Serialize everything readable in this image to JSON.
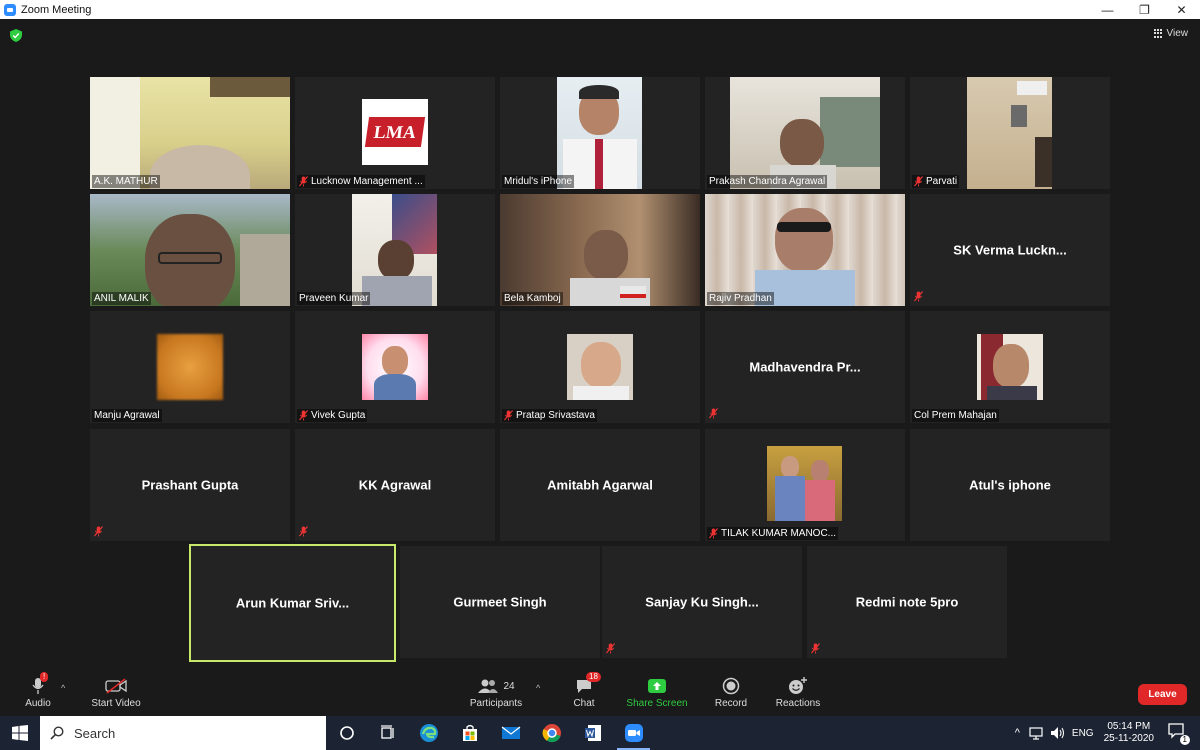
{
  "window": {
    "title": "Zoom Meeting",
    "minimize": "—",
    "restore": "❐",
    "close": "✕"
  },
  "meeting": {
    "view_label": "View",
    "participants": [
      {
        "name": "A.K. MATHUR",
        "muted": false
      },
      {
        "name": "Lucknow Management ...",
        "muted": true
      },
      {
        "name": "Mridul's iPhone",
        "muted": false
      },
      {
        "name": "Prakash Chandra Agrawal",
        "muted": false
      },
      {
        "name": "Parvati",
        "muted": true
      },
      {
        "name": "ANIL MALIK",
        "muted": false
      },
      {
        "name": "Praveen Kumar",
        "muted": false
      },
      {
        "name": "Bela Kamboj",
        "muted": false
      },
      {
        "name": "Rajiv Pradhan",
        "muted": false
      },
      {
        "name": "SK Verma Luckn...",
        "muted": true
      },
      {
        "name": "Manju Agrawal",
        "muted": false
      },
      {
        "name": "Vivek Gupta",
        "muted": true
      },
      {
        "name": "Pratap Srivastava",
        "muted": true
      },
      {
        "name": "Madhavendra Pr...",
        "muted": true
      },
      {
        "name": "Col Prem Mahajan",
        "muted": false
      },
      {
        "name": "Prashant Gupta",
        "muted": true
      },
      {
        "name": "KK Agrawal",
        "muted": true
      },
      {
        "name": "Amitabh Agarwal",
        "muted": false
      },
      {
        "name": "TILAK KUMAR MANOC...",
        "muted": true
      },
      {
        "name": "Atul's iphone",
        "muted": false
      },
      {
        "name": "Arun  Kumar  Sriv...",
        "muted": false
      },
      {
        "name": "Gurmeet Singh",
        "muted": false
      },
      {
        "name": "Sanjay  Ku  Singh...",
        "muted": true
      },
      {
        "name": "Redmi note 5pro",
        "muted": true
      }
    ],
    "logo_text": "LMA"
  },
  "toolbar": {
    "audio_label": "Audio",
    "audio_badge": "!",
    "video_label": "Start Video",
    "participants_label": "Participants",
    "participants_count": "24",
    "chat_label": "Chat",
    "chat_badge": "18",
    "share_label": "Share Screen",
    "record_label": "Record",
    "reactions_label": "Reactions",
    "leave_label": "Leave",
    "caret": "^"
  },
  "taskbar": {
    "search_placeholder": "Search",
    "language": "ENG",
    "time": "05:14 PM",
    "date": "25-11-2020",
    "notification_count": "1"
  },
  "colors": {
    "accent": "#2d8cff",
    "share_green": "#2ecc40",
    "leave_red": "#e02828",
    "active_speaker": "#c8e86a"
  }
}
